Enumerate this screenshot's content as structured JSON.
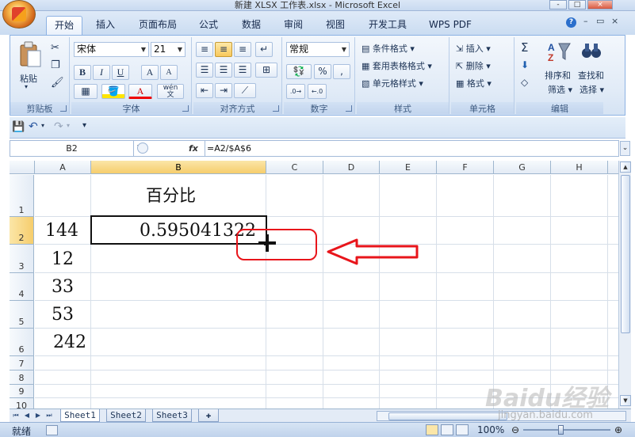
{
  "window": {
    "title": "新建 XLSX 工作表.xlsx - Microsoft Excel",
    "controls": [
      "-",
      "□",
      "×"
    ]
  },
  "tabs": [
    "开始",
    "插入",
    "页面布局",
    "公式",
    "数据",
    "审阅",
    "视图",
    "开发工具",
    "WPS PDF"
  ],
  "active_tab": "开始",
  "ribbon": {
    "clipboard": {
      "label": "剪贴板",
      "paste": "粘贴"
    },
    "font": {
      "label": "字体",
      "name": "宋体",
      "size": "21",
      "bold": "B",
      "italic": "I",
      "underline": "U",
      "grow": "A",
      "shrink": "A",
      "color_letter": "A",
      "phonetic": "wén"
    },
    "alignment": {
      "label": "对齐方式"
    },
    "number": {
      "label": "数字",
      "format": "常规",
      "percent": "%",
      "comma": ","
    },
    "styles": {
      "label": "样式",
      "conditional": "条件格式",
      "table": "套用表格格式",
      "cell_style": "单元格样式"
    },
    "cells": {
      "label": "单元格",
      "insert": "插入",
      "delete": "删除",
      "format": "格式"
    },
    "editing": {
      "label": "编辑",
      "sum": "Σ",
      "sort_filter": "排序和\n筛选",
      "sort_line1": "排序和",
      "sort_line2": "筛选",
      "find_line1": "查找和",
      "find_line2": "选择"
    }
  },
  "formula_bar": {
    "name_box": "B2",
    "fx": "fx",
    "formula": "=A2/$A$6"
  },
  "grid": {
    "columns": [
      "A",
      "B",
      "C",
      "D",
      "E",
      "F",
      "G",
      "H"
    ],
    "rows": [
      "1",
      "2",
      "3",
      "4",
      "5",
      "6",
      "7",
      "8",
      "9",
      "10"
    ],
    "cells": {
      "B1": "百分比",
      "A2": "144",
      "B2": "0.595041322",
      "A3": "12",
      "A4": "33",
      "A5": "53",
      "A6": "242"
    },
    "selected_cell": "B2"
  },
  "sheets": [
    "Sheet1",
    "Sheet2",
    "Sheet3"
  ],
  "active_sheet": "Sheet1",
  "status": {
    "text": "就绪",
    "zoom": "100%"
  },
  "watermark": {
    "brand": "Baidu经验",
    "url": "jingyan.baidu.com"
  },
  "colors": {
    "annotation": "#e8151b",
    "selection_header": "#f6cd6c",
    "ribbon": "#dbe7f6"
  }
}
